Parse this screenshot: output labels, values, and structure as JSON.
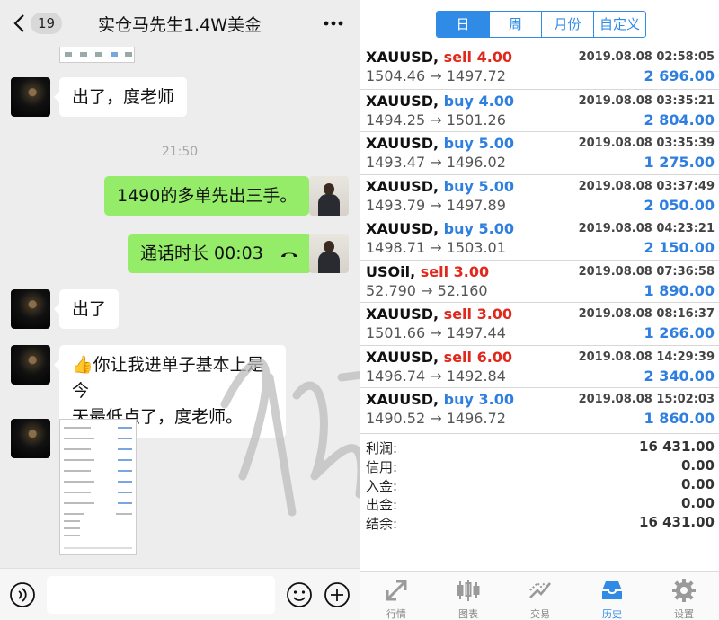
{
  "chat": {
    "unread_count": "19",
    "title": "实仓马先生1.4W美金",
    "timestamp": "21:50",
    "messages": [
      {
        "text": "出了，度老师"
      },
      {
        "text": "1490的多单先出三手。"
      },
      {
        "text": "通话时长 00:03"
      },
      {
        "text": "出了"
      },
      {
        "emoji": "👍",
        "line1": "你让我进单子基本上是今",
        "line2": "天最低点了，度老师。"
      }
    ]
  },
  "history": {
    "period_tabs": [
      {
        "label": "日",
        "active": true
      },
      {
        "label": "周"
      },
      {
        "label": "月份"
      },
      {
        "label": "自定义"
      }
    ],
    "trades": [
      {
        "symbol": "XAUUSD,",
        "side": "sell 4.00",
        "side_type": "sell",
        "prices": "1504.46 → 1497.72",
        "datetime": "2019.08.08 02:58:05",
        "profit": "2 696.00"
      },
      {
        "symbol": "XAUUSD,",
        "side": "buy 4.00",
        "side_type": "buy",
        "prices": "1494.25 → 1501.26",
        "datetime": "2019.08.08 03:35:21",
        "profit": "2 804.00"
      },
      {
        "symbol": "XAUUSD,",
        "side": "buy 5.00",
        "side_type": "buy",
        "prices": "1493.47 → 1496.02",
        "datetime": "2019.08.08 03:35:39",
        "profit": "1 275.00"
      },
      {
        "symbol": "XAUUSD,",
        "side": "buy 5.00",
        "side_type": "buy",
        "prices": "1493.79 → 1497.89",
        "datetime": "2019.08.08 03:37:49",
        "profit": "2 050.00"
      },
      {
        "symbol": "XAUUSD,",
        "side": "buy 5.00",
        "side_type": "buy",
        "prices": "1498.71 → 1503.01",
        "datetime": "2019.08.08 04:23:21",
        "profit": "2 150.00"
      },
      {
        "symbol": "USOil,",
        "side": "sell 3.00",
        "side_type": "sell",
        "prices": "52.790 → 52.160",
        "datetime": "2019.08.08 07:36:58",
        "profit": "1 890.00"
      },
      {
        "symbol": "XAUUSD,",
        "side": "sell 3.00",
        "side_type": "sell",
        "prices": "1501.66 → 1497.44",
        "datetime": "2019.08.08 08:16:37",
        "profit": "1 266.00"
      },
      {
        "symbol": "XAUUSD,",
        "side": "sell 6.00",
        "side_type": "sell",
        "prices": "1496.74 → 1492.84",
        "datetime": "2019.08.08 14:29:39",
        "profit": "2 340.00"
      },
      {
        "symbol": "XAUUSD,",
        "side": "buy 3.00",
        "side_type": "buy",
        "prices": "1490.52 → 1496.72",
        "datetime": "2019.08.08 15:02:03",
        "profit": "1 860.00"
      }
    ],
    "summary": [
      {
        "label": "利润:",
        "value": "16 431.00"
      },
      {
        "label": "信用:",
        "value": "0.00"
      },
      {
        "label": "入金:",
        "value": "0.00"
      },
      {
        "label": "出金:",
        "value": "0.00"
      },
      {
        "label": "结余:",
        "value": "16 431.00"
      }
    ],
    "nav": [
      {
        "label": "行情",
        "icon": "quotes-icon"
      },
      {
        "label": "图表",
        "icon": "chart-icon"
      },
      {
        "label": "交易",
        "icon": "trade-icon"
      },
      {
        "label": "历史",
        "icon": "history-icon",
        "active": true
      },
      {
        "label": "设置",
        "icon": "settings-icon"
      }
    ]
  },
  "colors": {
    "accent": "#2f8be6",
    "sell": "#e0291c",
    "buy": "#2f7fe0",
    "bubble_out": "#95ec69",
    "chat_bg": "#ededed"
  }
}
